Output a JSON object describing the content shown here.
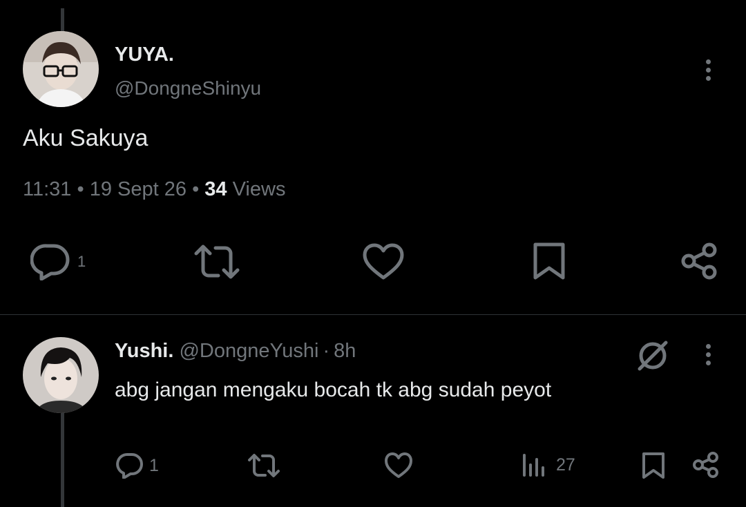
{
  "tweet": {
    "name": "YUYA.",
    "handle": "@DongneShinyu",
    "text": "Aku Sakuya",
    "time": "11:31",
    "date": "19 Sept 26",
    "views_count": "34",
    "views_label": "Views",
    "reply_count": "1",
    "icons": [
      "reply-icon",
      "retweet-icon",
      "like-icon",
      "bookmark-icon",
      "share-icon",
      "more-icon"
    ]
  },
  "reply": {
    "name": "Yushi.",
    "handle": "@DongneYushi",
    "separator": "·",
    "time": "8h",
    "text": "abg jangan mengaku bocah tk abg sudah peyot",
    "reply_count": "1",
    "views_count": "27",
    "icons": [
      "reply-icon",
      "retweet-icon",
      "like-icon",
      "views-icon",
      "bookmark-icon",
      "share-icon",
      "grok-icon",
      "more-icon"
    ]
  },
  "colors": {
    "background": "#000000",
    "text": "#e7e9ea",
    "secondary": "#71767b",
    "divider": "#2f3336"
  }
}
